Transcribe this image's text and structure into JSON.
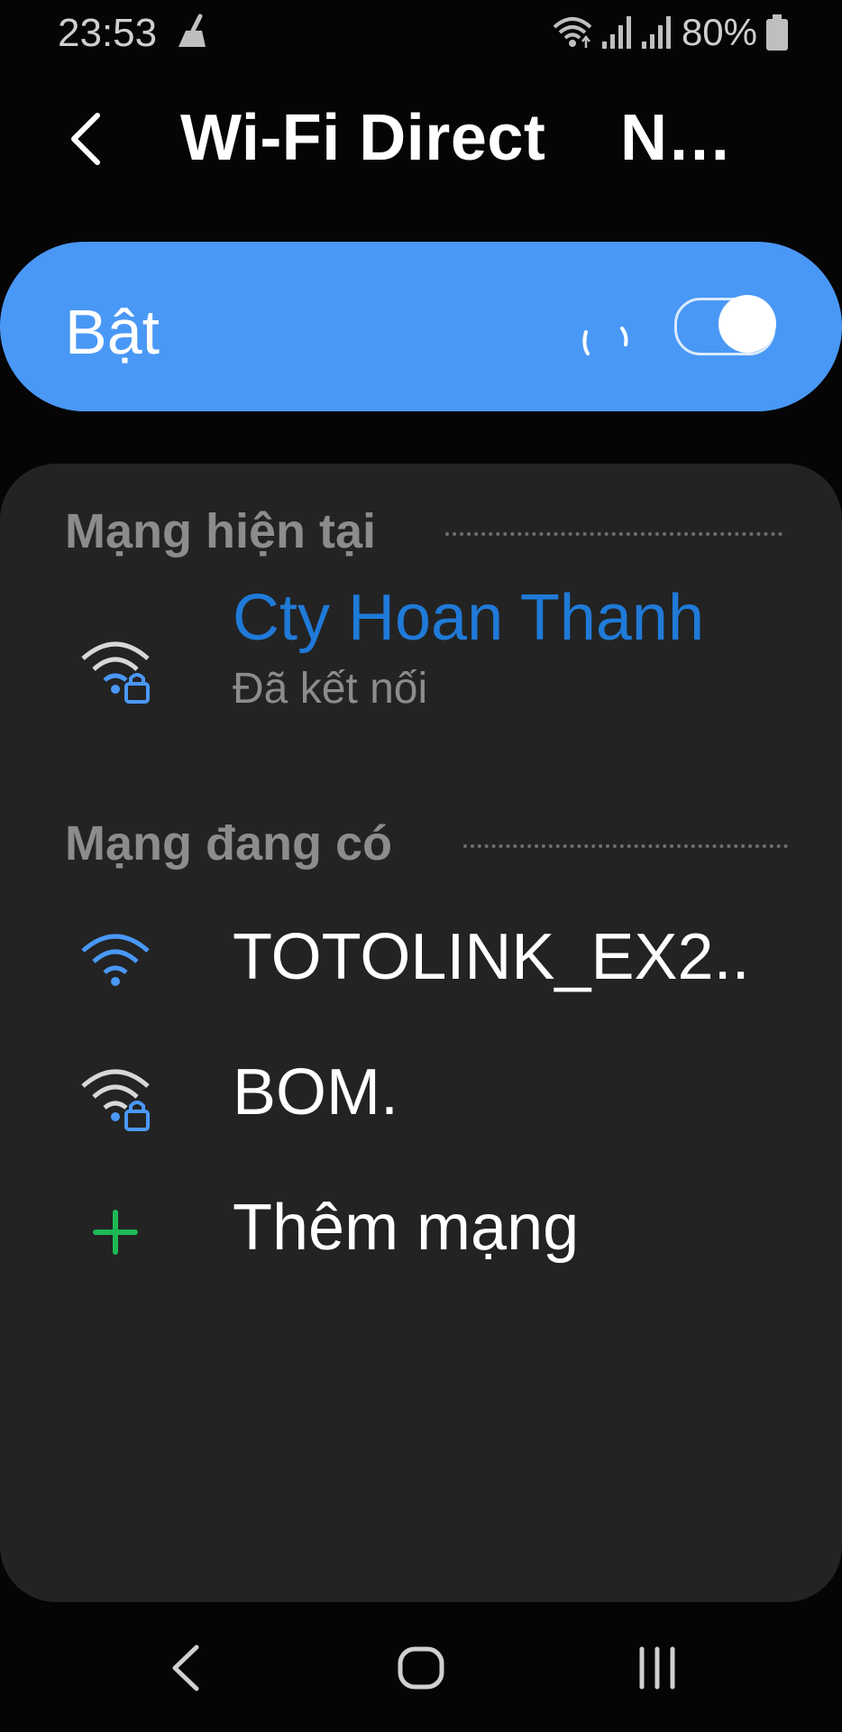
{
  "status_bar": {
    "time": "23:53",
    "battery": "80%",
    "icons": [
      "cleaner-icon",
      "wifi-data-icon",
      "signal-icon",
      "signal-icon",
      "battery-icon"
    ]
  },
  "header": {
    "title": "Wi-Fi Direct",
    "advanced": "Nâng cao",
    "advanced_display": "Nâ..."
  },
  "toggle": {
    "label": "Bật",
    "state": "on",
    "scanning": true
  },
  "current_network": {
    "heading": "Mạng hiện tại",
    "name": "Cty Hoan Thanh",
    "status": "Đã kết nối",
    "secured": true
  },
  "available": {
    "heading": "Mạng đang có",
    "items": [
      {
        "name": "TOTOLINK_EX2..",
        "secured": false
      },
      {
        "name": "BOM.",
        "secured": true
      }
    ]
  },
  "add_network": {
    "label": "Thêm mạng"
  },
  "colors": {
    "accent": "#4a98f6",
    "connected_text": "#1f7ad8",
    "add_icon": "#1db954"
  }
}
